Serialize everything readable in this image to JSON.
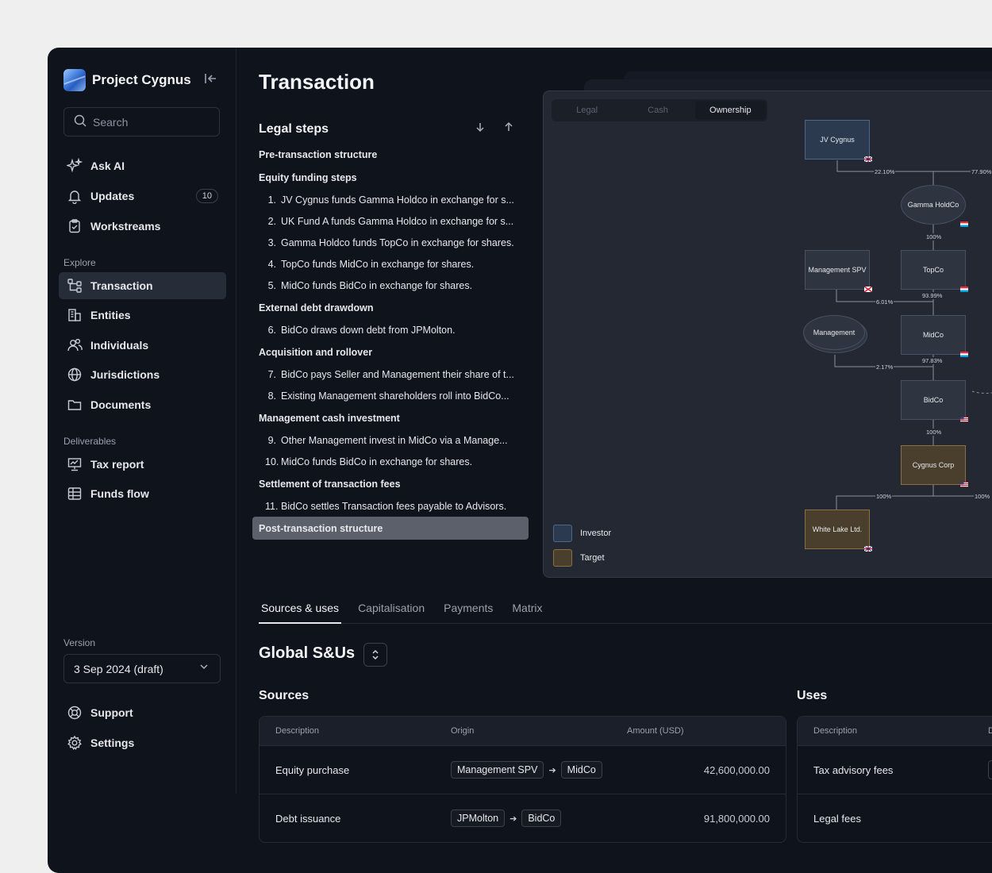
{
  "app": {
    "name": "Project Cygnus",
    "search_placeholder": "Search"
  },
  "sidebar": {
    "top_items": [
      {
        "label": "Ask AI",
        "icon": "sparkles-icon"
      },
      {
        "label": "Updates",
        "icon": "bell-icon",
        "badge": "10"
      },
      {
        "label": "Workstreams",
        "icon": "clipboard-icon"
      }
    ],
    "explore_label": "Explore",
    "explore_items": [
      {
        "label": "Transaction",
        "icon": "flow-icon",
        "active": true
      },
      {
        "label": "Entities",
        "icon": "building-icon"
      },
      {
        "label": "Individuals",
        "icon": "users-icon"
      },
      {
        "label": "Jurisdictions",
        "icon": "globe-icon"
      },
      {
        "label": "Documents",
        "icon": "folder-icon"
      }
    ],
    "deliverables_label": "Deliverables",
    "deliverables_items": [
      {
        "label": "Tax report",
        "icon": "presentation-icon"
      },
      {
        "label": "Funds flow",
        "icon": "table-icon"
      }
    ],
    "version_label": "Version",
    "version_value": "3 Sep 2024 (draft)",
    "bottom_items": [
      {
        "label": "Support",
        "icon": "lifebuoy-icon"
      },
      {
        "label": "Settings",
        "icon": "gear-icon"
      }
    ]
  },
  "page": {
    "title": "Transaction"
  },
  "legal_steps": {
    "title": "Legal steps",
    "items": [
      {
        "type": "group",
        "label": "Pre-transaction structure"
      },
      {
        "type": "group",
        "label": "Equity funding steps"
      },
      {
        "type": "sub",
        "num": "1.",
        "label": "JV Cygnus funds Gamma Holdco in exchange for s..."
      },
      {
        "type": "sub",
        "num": "2.",
        "label": "UK Fund A funds Gamma Holdco in exchange for s..."
      },
      {
        "type": "sub",
        "num": "3.",
        "label": "Gamma Holdco funds TopCo in exchange for shares."
      },
      {
        "type": "sub",
        "num": "4.",
        "label": "TopCo funds MidCo in exchange for shares."
      },
      {
        "type": "sub",
        "num": "5.",
        "label": "MidCo funds BidCo in exchange for shares."
      },
      {
        "type": "group",
        "label": "External debt drawdown"
      },
      {
        "type": "sub",
        "num": "6.",
        "label": "BidCo draws down debt from JPMolton."
      },
      {
        "type": "group",
        "label": "Acquisition and rollover"
      },
      {
        "type": "sub",
        "num": "7.",
        "label": "BidCo pays Seller and Management their share of t..."
      },
      {
        "type": "sub",
        "num": "8.",
        "label": "Existing Management shareholders roll into BidCo..."
      },
      {
        "type": "group",
        "label": "Management cash investment"
      },
      {
        "type": "sub",
        "num": "9.",
        "label": "Other Management invest in MidCo via a Manage..."
      },
      {
        "type": "sub",
        "num": "10.",
        "label": "MidCo funds BidCo in exchange for shares."
      },
      {
        "type": "group",
        "label": "Settlement of transaction fees"
      },
      {
        "type": "sub",
        "num": "11.",
        "label": "BidCo settles Transaction fees payable to Advisors."
      },
      {
        "type": "selected",
        "label": "Post-transaction structure"
      }
    ]
  },
  "diagram": {
    "tabs": [
      "Legal",
      "Cash",
      "Ownership"
    ],
    "active_tab": "Ownership",
    "nodes": {
      "jv_cygnus": "JV Cygnus",
      "gamma_holdco": "Gamma HoldCo",
      "management_spv": "Management SPV",
      "topco": "TopCo",
      "management": "Management",
      "midco": "MidCo",
      "bidco": "BidCo",
      "cygnus_corp": "Cygnus Corp",
      "white_lake": "White Lake Ltd."
    },
    "percentages": {
      "jv_to_gamma": "22.10%",
      "right_to_gamma": "77.90%",
      "gamma_to_topco": "100%",
      "topco_to_midco": "93.99%",
      "spv_to_midco": "6.01%",
      "management_to_bidco": "2.17%",
      "midco_to_bidco": "97.83%",
      "bidco_to_cygnus": "100%",
      "cygnus_to_whitelake": "100%",
      "cygnus_to_right": "100%"
    },
    "legend": [
      {
        "label": "Investor",
        "color": "#2b3a4f"
      },
      {
        "label": "Target",
        "color": "#4a3e2c"
      }
    ]
  },
  "bottom_tabs": [
    "Sources & uses",
    "Capitalisation",
    "Payments",
    "Matrix"
  ],
  "active_bottom_tab": "Sources & uses",
  "sources_uses": {
    "title": "Global S&Us",
    "sources": {
      "title": "Sources",
      "columns": [
        "Description",
        "Origin",
        "Amount (USD)"
      ],
      "rows": [
        {
          "description": "Equity purchase",
          "from": "Management SPV",
          "to": "MidCo",
          "amount": "42,600,000.00"
        },
        {
          "description": "Debt issuance",
          "from": "JPMolton",
          "to": "BidCo",
          "amount": "91,800,000.00"
        }
      ]
    },
    "uses": {
      "title": "Uses",
      "columns": [
        "Description",
        "D"
      ],
      "rows": [
        {
          "description": "Tax advisory fees"
        },
        {
          "description": "Legal fees"
        }
      ]
    }
  }
}
